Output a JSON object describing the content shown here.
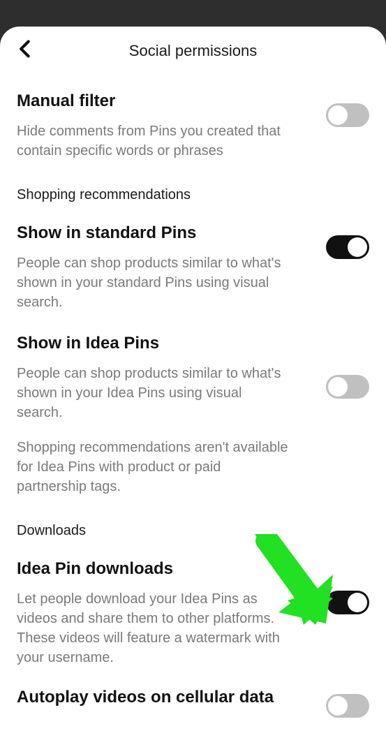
{
  "header": {
    "title": "Social permissions"
  },
  "manual_filter": {
    "title": "Manual filter",
    "desc": "Hide comments from Pins you created that contain specific words or phrases",
    "enabled": false
  },
  "shopping": {
    "section_label": "Shopping recommendations",
    "standard": {
      "title": "Show in standard Pins",
      "desc": "People can shop products similar to what's shown in your standard Pins using visual search.",
      "enabled": true
    },
    "idea": {
      "title": "Show in Idea Pins",
      "desc": "People can shop products similar to what's shown in your Idea Pins using visual search.",
      "extra": "Shopping recommendations aren't available for Idea Pins with product or paid partnership tags.",
      "enabled": false
    }
  },
  "downloads": {
    "section_label": "Downloads",
    "idea_pin": {
      "title": "Idea Pin downloads",
      "desc": "Let people download your Idea Pins as videos and share them to other platforms. These videos will feature a watermark with your username.",
      "enabled": true
    },
    "autoplay": {
      "title": "Autoplay videos on cellular data",
      "enabled": false
    }
  }
}
